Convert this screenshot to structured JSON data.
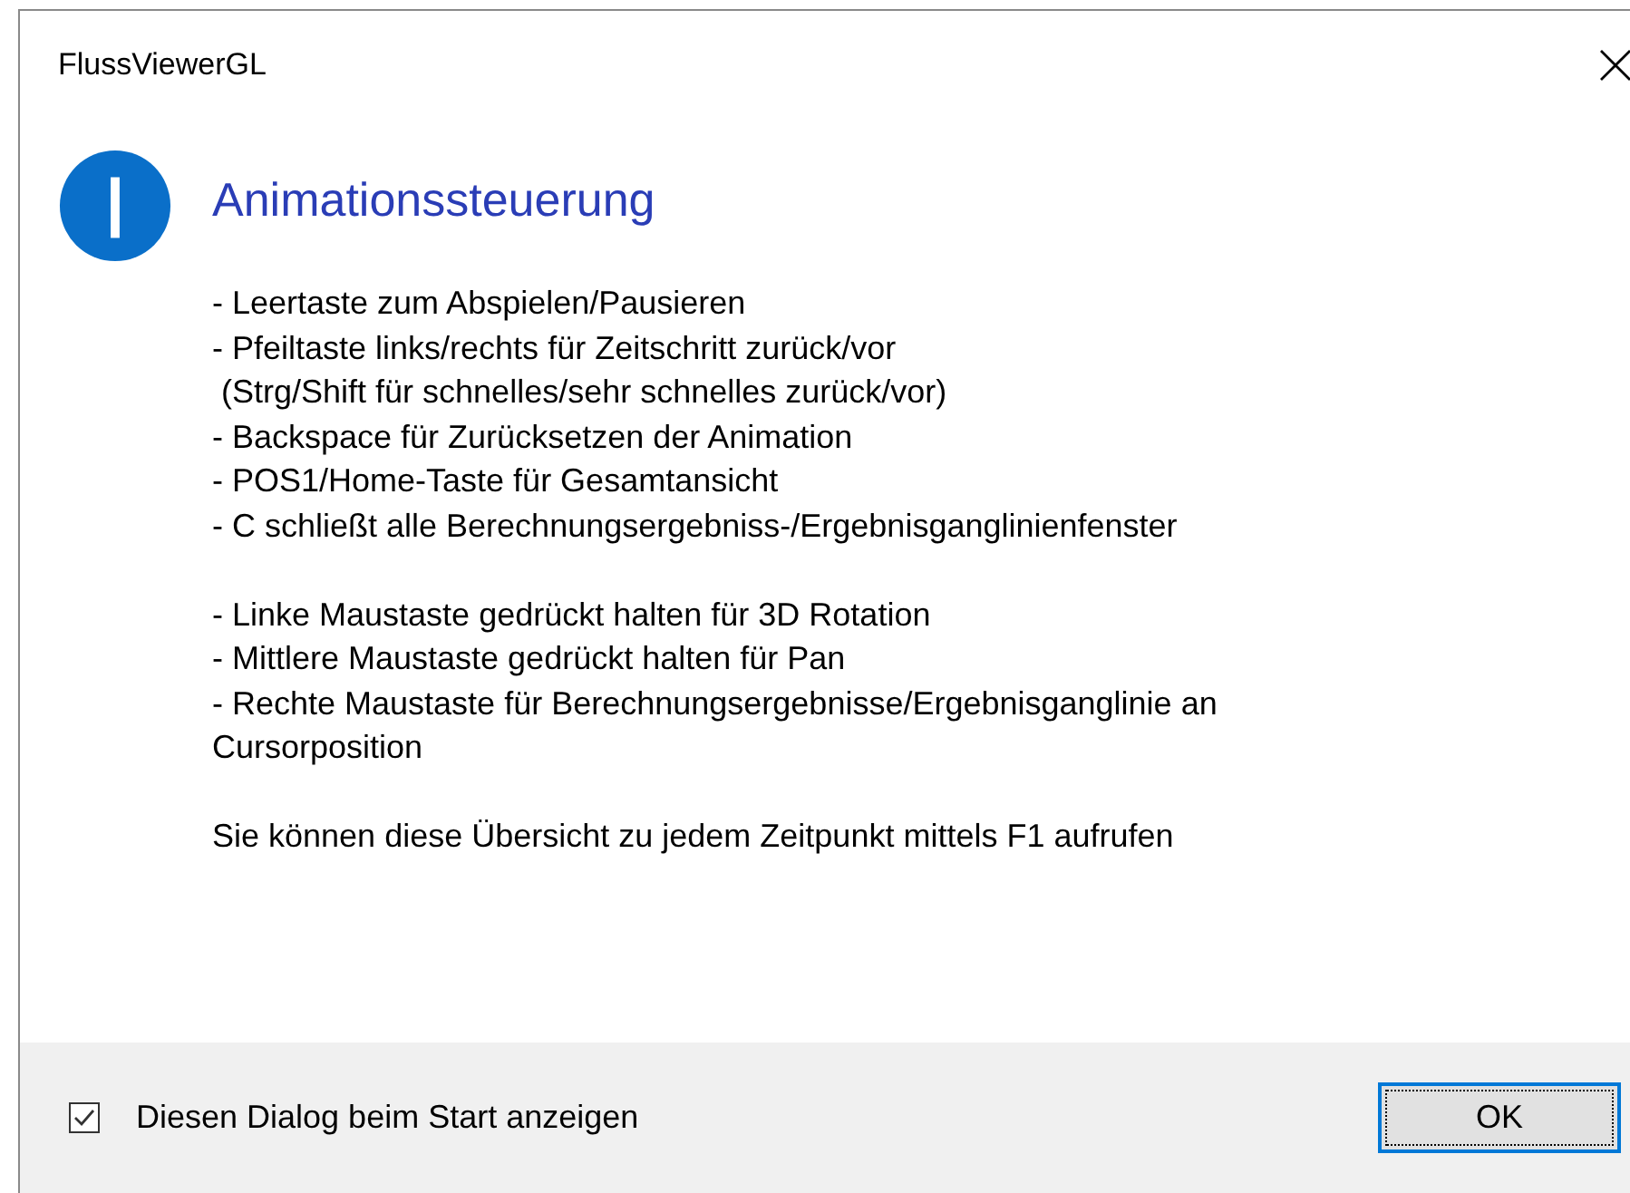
{
  "window": {
    "title": "FlussViewerGL"
  },
  "heading": "Animationssteuerung",
  "paragraphs": [
    [
      "- Leertaste zum Abspielen/Pausieren",
      "- Pfeiltaste links/rechts für Zeitschritt zurück/vor",
      " (Strg/Shift für schnelles/sehr schnelles zurück/vor)",
      "- Backspace für Zurücksetzen der Animation",
      "- POS1/Home-Taste für Gesamtansicht",
      "- C schließt alle Berechnungsergebniss-/Ergebnisganglinienfenster"
    ],
    [
      "- Linke Maustaste gedrückt halten für 3D Rotation",
      "- Mittlere Maustaste gedrückt halten für Pan",
      "- Rechte Maustaste für Berechnungsergebnisse/Ergebnisganglinie an",
      "Cursorposition"
    ],
    [
      "Sie können diese Übersicht zu jedem Zeitpunkt mittels F1 aufrufen"
    ]
  ],
  "checkbox": {
    "label": "Diesen Dialog beim Start anzeigen",
    "checked": true
  },
  "buttons": [
    "OK"
  ]
}
